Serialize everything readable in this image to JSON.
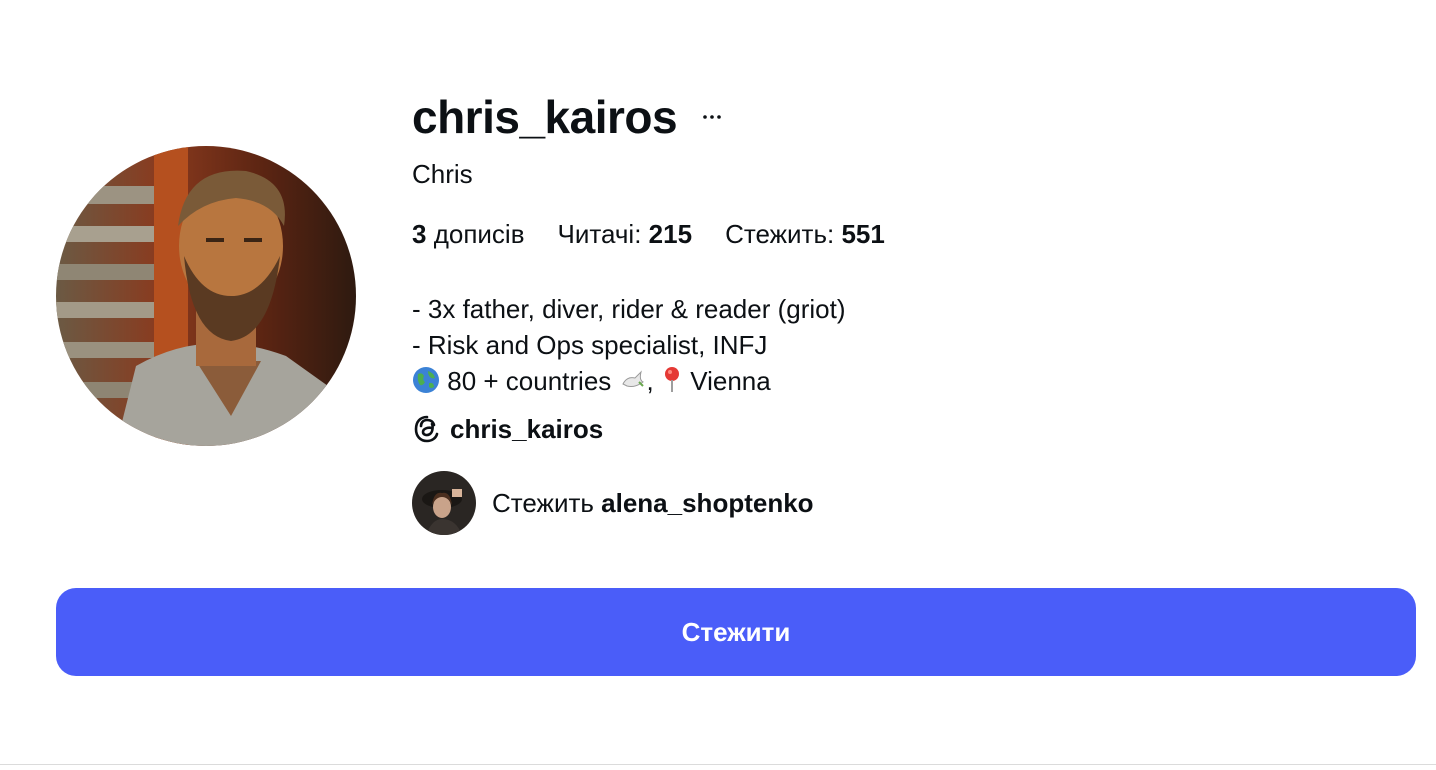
{
  "profile": {
    "username": "chris_kairos",
    "full_name": "Chris",
    "more_icon": "more-horizontal-icon",
    "stats": {
      "posts_count": "3",
      "posts_label": "дописів",
      "followers_label": "Читачі: ",
      "followers_count": "215",
      "following_label": "Стежить: ",
      "following_count": "551"
    },
    "bio": {
      "line1": "- 3x father, diver, rider & reader (griot)",
      "line2": "- Risk and Ops specialist, INFJ",
      "line3_part1": "80 + countries",
      "line3_part2": ",",
      "line3_part3": "Vienna",
      "line3_emoji_globe": "globe-icon",
      "line3_emoji_dove": "dove-icon",
      "line3_emoji_pin": "pushpin-icon"
    },
    "threads": {
      "icon": "threads-icon",
      "handle": "chris_kairos"
    },
    "followed_by": {
      "prefix": "Стежить ",
      "username": "alena_shoptenko"
    }
  },
  "actions": {
    "follow_label": "Стежити"
  },
  "colors": {
    "accent": "#4a5df9",
    "text": "#0c1014",
    "background": "#ffffff"
  }
}
